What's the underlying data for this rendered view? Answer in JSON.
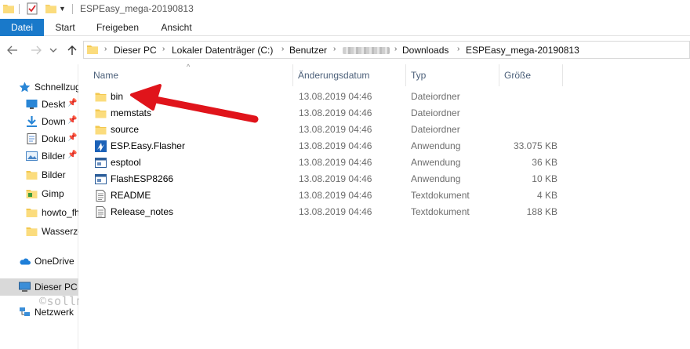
{
  "window": {
    "title": "ESPEasy_mega-20190813"
  },
  "ribbon": {
    "tabs": [
      {
        "label": "Datei"
      },
      {
        "label": "Start"
      },
      {
        "label": "Freigeben"
      },
      {
        "label": "Ansicht"
      }
    ],
    "accent_color": "#1979ca"
  },
  "address": {
    "crumbs": [
      {
        "label": "Dieser PC"
      },
      {
        "label": "Lokaler Datenträger (C:)"
      },
      {
        "label": "Benutzer"
      },
      {
        "label": "Downloads"
      },
      {
        "label": "ESPEasy_mega-20190813"
      }
    ]
  },
  "sidebar": {
    "items": [
      {
        "label": "Schnellzugriff",
        "icon": "star-icon"
      },
      {
        "label": "Desktop",
        "icon": "desktop-icon",
        "pinned": true
      },
      {
        "label": "Downloads",
        "icon": "download-icon",
        "pinned": true
      },
      {
        "label": "Dokumente",
        "icon": "document-icon",
        "pinned": true
      },
      {
        "label": "Bilder",
        "icon": "pictures-icon",
        "pinned": true
      },
      {
        "label": "Bilder",
        "icon": "folder-icon"
      },
      {
        "label": "Gimp",
        "icon": "folder-icon"
      },
      {
        "label": "howto_fhem",
        "icon": "folder-icon"
      },
      {
        "label": "Wasserzeichen",
        "icon": "folder-icon"
      },
      {
        "label": "OneDrive",
        "icon": "cloud-icon"
      },
      {
        "label": "Dieser PC",
        "icon": "computer-icon"
      },
      {
        "label": "Netzwerk",
        "icon": "network-icon"
      }
    ],
    "pin_glyph": "📌"
  },
  "columns": {
    "name": "Name",
    "date": "Änderungsdatum",
    "type": "Typ",
    "size": "Größe"
  },
  "files": [
    {
      "name": "bin",
      "date": "13.08.2019 04:46",
      "type": "Dateiordner",
      "size": "",
      "icon": "folder-icon"
    },
    {
      "name": "memstats",
      "date": "13.08.2019 04:46",
      "type": "Dateiordner",
      "size": "",
      "icon": "folder-icon"
    },
    {
      "name": "source",
      "date": "13.08.2019 04:46",
      "type": "Dateiordner",
      "size": "",
      "icon": "folder-icon"
    },
    {
      "name": "ESP.Easy.Flasher",
      "date": "13.08.2019 04:46",
      "type": "Anwendung",
      "size": "33.075 KB",
      "icon": "flasher-app-icon"
    },
    {
      "name": "esptool",
      "date": "13.08.2019 04:46",
      "type": "Anwendung",
      "size": "36 KB",
      "icon": "application-icon"
    },
    {
      "name": "FlashESP8266",
      "date": "13.08.2019 04:46",
      "type": "Anwendung",
      "size": "10 KB",
      "icon": "application-icon"
    },
    {
      "name": "README",
      "date": "13.08.2019 04:46",
      "type": "Textdokument",
      "size": "4 KB",
      "icon": "text-file-icon"
    },
    {
      "name": "Release_notes",
      "date": "13.08.2019 04:46",
      "type": "Textdokument",
      "size": "188 KB",
      "icon": "text-file-icon"
    }
  ],
  "watermark": "©sollmaker.de",
  "annotation": {
    "icon": "red-arrow-icon",
    "color": "#e0141b"
  }
}
